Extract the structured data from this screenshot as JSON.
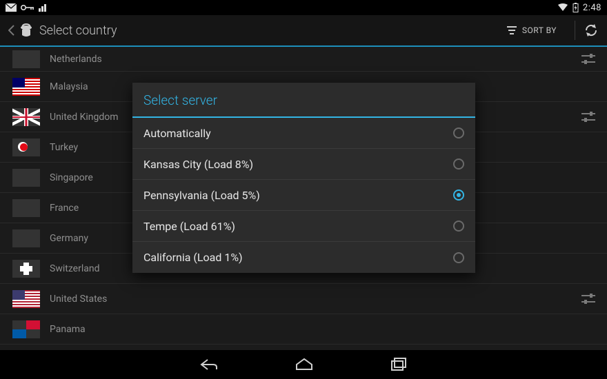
{
  "statusbar": {
    "time": "2:48"
  },
  "actionbar": {
    "title": "Select country",
    "sort_label": "SORT BY"
  },
  "countries": [
    {
      "name": "Netherlands",
      "flag": "nl",
      "tune": true
    },
    {
      "name": "Malaysia",
      "flag": "my",
      "tune": false
    },
    {
      "name": "United Kingdom",
      "flag": "uk",
      "tune": true
    },
    {
      "name": "Turkey",
      "flag": "tr",
      "tune": false
    },
    {
      "name": "Singapore",
      "flag": "sg",
      "tune": false
    },
    {
      "name": "France",
      "flag": "fr",
      "tune": false
    },
    {
      "name": "Germany",
      "flag": "de",
      "tune": false
    },
    {
      "name": "Switzerland",
      "flag": "ch",
      "tune": false
    },
    {
      "name": "United States",
      "flag": "us",
      "tune": true
    },
    {
      "name": "Panama",
      "flag": "pa",
      "tune": false
    }
  ],
  "dialog": {
    "title": "Select server",
    "options": [
      {
        "label": "Automatically",
        "selected": false
      },
      {
        "label": "Kansas City (Load 8%)",
        "selected": false
      },
      {
        "label": "Pennsylvania (Load 5%)",
        "selected": true
      },
      {
        "label": "Tempe (Load 61%)",
        "selected": false
      },
      {
        "label": "California (Load 1%)",
        "selected": false
      }
    ]
  }
}
